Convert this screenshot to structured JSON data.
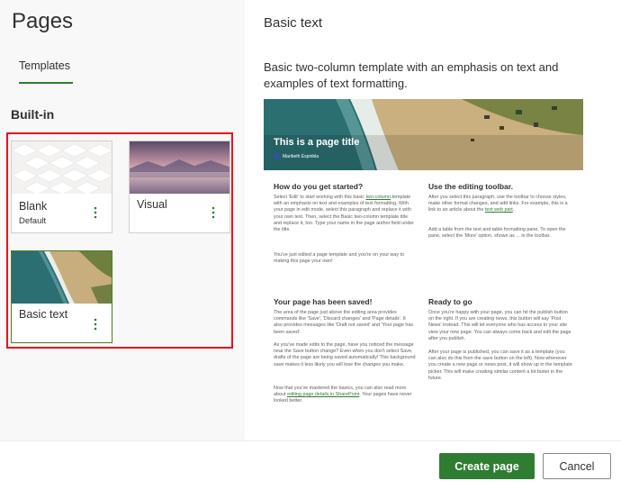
{
  "panel": {
    "title": "Pages",
    "tab": "Templates",
    "section": "Built-in"
  },
  "templates": [
    {
      "name": "Blank",
      "subtitle": "Default"
    },
    {
      "name": "Visual",
      "subtitle": ""
    },
    {
      "name": "Basic text",
      "subtitle": ""
    }
  ],
  "more_glyph": "⋮",
  "preview": {
    "name": "Basic text",
    "description": "Basic two-column template with an emphasis on text and examples of text formatting.",
    "hero_title": "This is a page title",
    "hero_author": "Maribeth Espinbla",
    "sections": [
      {
        "heading": "How do you get started?",
        "pre": "Select 'Edit' to start working with this basic ",
        "link": "two-column",
        "post": " template with an emphasis on text and examples of text formatting. With your page in edit mode, select this paragraph and replace it with your own text. Then, select the Basic two-column template title and replace it, too. Type your name in the page author field under the title.",
        "extra": "You've just edited a page template and you're on your way to making this page your own!"
      },
      {
        "heading": "Use the editing toolbar.",
        "pre": "After you select this paragraph, use the toolbar to choose styles, make other format changes, and add links. For example, this is a link to an article about the ",
        "link": "text web part",
        "post": ".",
        "extra": "Add a table from the text and table formatting pane. To open the pane, select the 'More' option, shown as ... in the toolbar."
      },
      {
        "heading": "Your page has been saved!",
        "pre": "The area of the page just above the editing area provides commands like 'Save', 'Discard changes' and 'Page details'. It also provides messages like 'Draft not saved' and 'Your page has been saved'.",
        "link": "",
        "post": "",
        "extra": "As you've made edits to the page, have you noticed the message near the Save button change? Even when you don't select Save, drafts of the page are being saved automatically! This background save makes it less likely you will lose the changes you make.",
        "extra2_pre": "Now that you've mastered the basics, you can also read more about ",
        "extra2_link": "editing page details in SharePoint",
        "extra2_post": ". Your pages have never looked better."
      },
      {
        "heading": "Ready to go",
        "pre": "Once you're happy with your page, you can hit the publish button on the right. If you are creating news, this button will say 'Post News' instead. This will let everyone who has access to your site view your new page. You can always come back and edit the page after you publish.",
        "link": "",
        "post": "",
        "extra": "After your page is published, you can save it as a template (you can also do this from the save button on the left). Now whenever you create a new page or news post, it will show up in the template picker. This will make creating similar content a lot faster in the future."
      }
    ]
  },
  "footer": {
    "create_label": "Create page",
    "cancel_label": "Cancel"
  },
  "colors": {
    "accent": "#2e7d32",
    "highlight_frame": "#e8101c"
  }
}
